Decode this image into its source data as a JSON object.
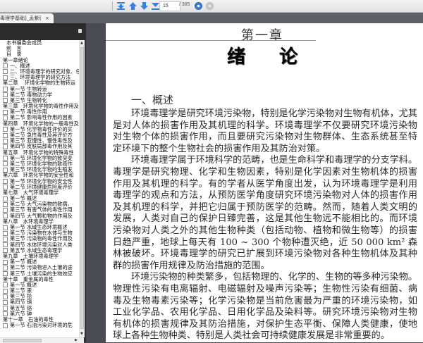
{
  "toolbar": {
    "buttons": [
      "first-page",
      "previous-page",
      "next-page",
      "last-page"
    ],
    "current_page": "15",
    "total_pages": "/ 385",
    "colors": {
      "accent": "#3d7fd6",
      "disabled": "#c9c9c9"
    }
  },
  "tab": {
    "title": "毒理学基础]_孟紫强....",
    "close": "×"
  },
  "tree": [
    {
      "type": "top",
      "label": "本书编委会成员"
    },
    {
      "type": "top",
      "label": "前　言"
    },
    {
      "type": "top",
      "label": "目　录"
    },
    {
      "type": "ch",
      "label": "第一章绪论"
    },
    {
      "type": "sec",
      "num": "",
      "label": "一、概述"
    },
    {
      "type": "sec",
      "num": "",
      "label": "二、环境毒理学的研究对象、任"
    },
    {
      "type": "sec",
      "num": "",
      "label": "三、环境毒理学的研究方法"
    },
    {
      "type": "ch",
      "label": "第二章　 环境化学物的生物转运"
    },
    {
      "type": "sec",
      "num": "第一节",
      "label": "生物转运"
    },
    {
      "type": "sec",
      "num": "第二节",
      "label": "毒物动力学"
    },
    {
      "type": "sec",
      "num": "第三节",
      "label": "生物转化"
    },
    {
      "type": "ch",
      "label": "第三章　环境化学物的毒性作用及"
    },
    {
      "type": "sec",
      "num": "第一节",
      "label": "毒性作用"
    },
    {
      "type": "sec",
      "num": "第二节",
      "label": "影响毒性作用的因素"
    },
    {
      "type": "ch",
      "label": "第四章　环境化学物的一般毒性及"
    },
    {
      "type": "sec",
      "num": "第一节",
      "label": "化学物毒性评价的实"
    },
    {
      "type": "sec",
      "num": "第二节",
      "label": "急性毒性及其评价方"
    },
    {
      "type": "sec",
      "num": "第三节",
      "label": "亚慢性、慢性毒性及"
    },
    {
      "type": "sec",
      "num": "第四节",
      "label": "皮肤局部毒作用及其"
    },
    {
      "type": "ch",
      "label": "第五章　环境化学物的特殊毒性"
    },
    {
      "type": "sec",
      "num": "第一节",
      "label": "环境化学物的致突变"
    },
    {
      "type": "sec",
      "num": "第二节",
      "label": "环境化学物的致癌作"
    },
    {
      "type": "sec",
      "num": "第三节",
      "label": "环境化学物的生殖发"
    },
    {
      "type": "ch",
      "label": "第六章　环境化学物的安全性和"
    },
    {
      "type": "sec",
      "num": "第一节",
      "label": "环境化学物的安全性"
    },
    {
      "type": "sec",
      "num": "第二节",
      "label": "环境健康危险度评价"
    },
    {
      "type": "ch",
      "label": "第七章　大气环境毒理学"
    },
    {
      "type": "sec",
      "num": "第一节",
      "label": "概述"
    },
    {
      "type": "sec",
      "num": "第二节",
      "label": "大气污染物的致病、"
    },
    {
      "type": "sec",
      "num": "第三节",
      "label": "有害气体的毒性作用"
    },
    {
      "type": "sec",
      "num": "第四节",
      "label": "大气颗粒物的作用及"
    },
    {
      "type": "ch",
      "label": "第八章　水环境毒理学"
    },
    {
      "type": "sec",
      "num": "第一节",
      "label": "水域生态环境概述"
    },
    {
      "type": "sec",
      "num": "第二节",
      "label": "污染物在水体与生物"
    },
    {
      "type": "sec",
      "num": "第三节",
      "label": "污染物的毒性作用及"
    },
    {
      "type": "sec",
      "num": "第四节",
      "label": "水体环境污染对人类"
    },
    {
      "type": "sec",
      "num": "第五节",
      "label": "水域生态毒理学"
    },
    {
      "type": "ch",
      "label": "第九章　土壤环境毒理学"
    },
    {
      "type": "sec",
      "num": "第一节",
      "label": "概述"
    },
    {
      "type": "sec",
      "num": "第二节",
      "label": "污染物进入土壤的途"
    },
    {
      "type": "sec",
      "num": "第三节",
      "label": "土壤污染的生物效应"
    },
    {
      "type": "ch",
      "label": "第十章　重金属的毒性"
    },
    {
      "type": "sec",
      "num": "第一节",
      "label": "概述"
    },
    {
      "type": "sec",
      "num": "第二节",
      "label": "汞"
    },
    {
      "type": "sec",
      "num": "第三节",
      "label": "铅"
    },
    {
      "type": "sec",
      "num": "第四节",
      "label": "镉"
    },
    {
      "type": "sec",
      "num": "第五节",
      "label": "铬"
    },
    {
      "type": "sec",
      "num": "第六节",
      "label": "砷"
    },
    {
      "type": "ch",
      "label": "第十一章　石油的毒性"
    },
    {
      "type": "sec",
      "num": "第一节",
      "label": "石油污染对环境的危"
    }
  ],
  "page": {
    "chapter_number": "第一章",
    "chapter_title": "绪论",
    "section_title": "一、概述",
    "paragraphs": [
      "环境毒理学是研究环境污染物，特别是化学污染物对生物有机体，尤其是对人体的损害作用及其机理的科学。环境毒理学不仅要研究环境污染物对生物个体的损害作用，而且要研究污染物对生物群体、生态系统甚至特定环境下的整个生物社会的损害作用及其防治对策。",
      "环境毒理学属于环境科学的范畴，也是生命科学和毒理学的分支学科。毒理学是研究物理、化学和生物因素，特别是化学因素对生物机体的损害作用及其机理的科学。有的学者从医学角度出发，认为环境毒理学是利用毒理学的观点和方法，从预防医学角度研究环境污染物对人体的损害作用及其机理的科学，并把它归属于预防医学的范畴。然而，随着人类文明的发展，人类对自己的保护日臻完善，这是其他生物远不能相比的。而环境污染物对人类之外的其他生物种类（包括动物、植物和微生物等）的损害日趋严重，地球上每天有 100 ~ 300 个物种遭灭绝，近 50 000 km² 森林被破坏。环境毒理学的研究已扩展到环境污染物对各种生物机体及其种群的损害作用规律及防治措施的范围。",
      "环境污染物的种类繁多，包括物理的、化学的、生物的等多种污染物。物理性污染有电离辐射、电磁辐射及噪声污染等；生物性污染有细菌、病毒及生物毒素污染等；化学污染物是当前危害最为严重的环境污染物，如工业化学品、农用化学品、日用化学品及染料等。研究环境污染物对生物有机体的损害规律及其防治措施，对保护生态平衡、保障人类健康，使地球上各种生物种类、特别是人类社会可持续健康发展是非常重要的。"
    ]
  }
}
